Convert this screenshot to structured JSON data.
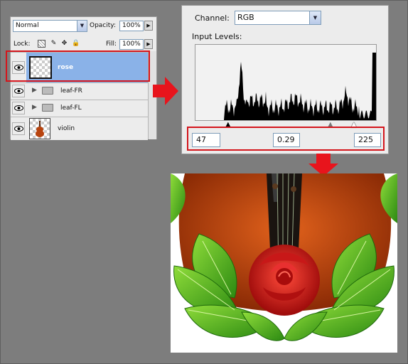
{
  "layers_panel": {
    "blend_mode": "Normal",
    "opacity_label": "Opacity:",
    "opacity_value": "100%",
    "lock_label": "Lock:",
    "fill_label": "Fill:",
    "fill_value": "100%",
    "layers": [
      {
        "name": "rose",
        "type": "layer",
        "selected": true
      },
      {
        "name": "leaf-FR",
        "type": "group"
      },
      {
        "name": "leaf-FL",
        "type": "group"
      },
      {
        "name": "violin",
        "type": "layer"
      }
    ]
  },
  "levels_panel": {
    "channel_label": "Channel:",
    "channel_value": "RGB",
    "input_levels_label": "Input Levels:",
    "black_point": "47",
    "gamma": "0.29",
    "white_point": "225"
  },
  "colors": {
    "highlight_red": "#d4151c",
    "selection_blue": "#8ab2e8",
    "background_gray": "#7d7d7d"
  }
}
